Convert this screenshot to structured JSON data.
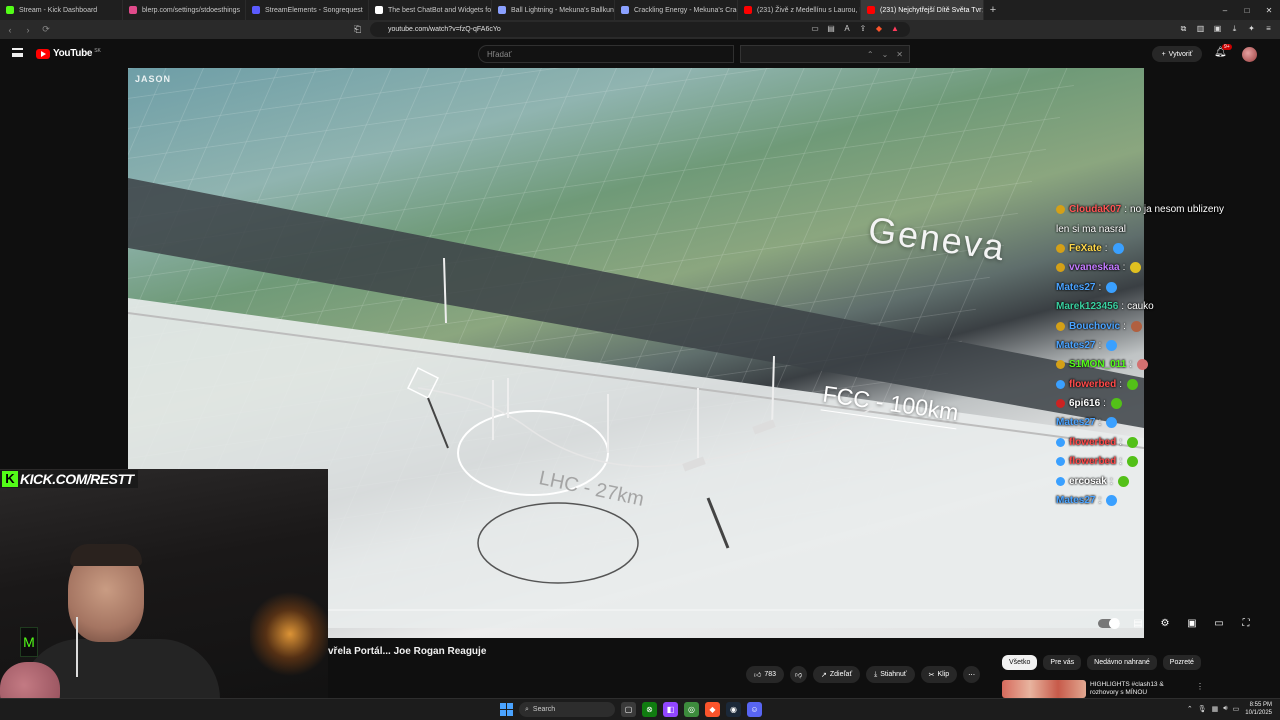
{
  "browser": {
    "tabs": [
      {
        "title": "Stream - Kick Dashboard",
        "color": "#53fc18",
        "active": false
      },
      {
        "title": "blerp.com/settings/stdoesthings",
        "color": "#e04a8a",
        "active": false
      },
      {
        "title": "StreamElements - Songrequest",
        "color": "#5b5bff",
        "active": false
      },
      {
        "title": "The best ChatBot and Widgets for K",
        "color": "#ffffff",
        "active": false
      },
      {
        "title": "Ball Lightning - Mekuna's Ballkuna",
        "color": "#8aa0ff",
        "active": false
      },
      {
        "title": "Crackling Energy - Mekuna's Crackli",
        "color": "#8aa0ff",
        "active": false
      },
      {
        "title": "(231) Živě z Medellínu s Laurou, Ko",
        "color": "#ff0000",
        "active": false
      },
      {
        "title": "(231) Nejchytřejší Dítě Světa Tvr",
        "color": "#ff0000",
        "active": true
      }
    ],
    "new_tab": "+",
    "url": "youtube.com/watch?v=fzQ-qFA6cYo",
    "window_controls": [
      "–",
      "□",
      "✕"
    ]
  },
  "masthead": {
    "logo_text": "YouTube",
    "country": "SK",
    "search_placeholder": "Hľadať",
    "create_label": "Vytvoriť",
    "notif_count": "9+"
  },
  "video": {
    "watermark": "JASON",
    "label_geneva": "Geneva",
    "label_fcc": "FCC - 100km",
    "label_lhc": "LHC - 27km",
    "progress_fraction": 0.06
  },
  "chat": [
    {
      "user": "CloudaK07",
      "color": "#ff5555",
      "badge": "#d4a017",
      "msg": "no ja nesom ublizeny"
    },
    {
      "user": "",
      "color": "#ffffff",
      "badge": "",
      "msg": "len si ma nasral"
    },
    {
      "user": "FeXate",
      "color": "#ffd84a",
      "badge": "#d4a017",
      "msg": "",
      "emote": "#3aa0ff"
    },
    {
      "user": "vvaneskaa",
      "color": "#c47aff",
      "badge": "#d4a017",
      "msg": "",
      "emote": "#e0c020"
    },
    {
      "user": "Mates27",
      "color": "#4aa3ff",
      "badge": "",
      "msg": "",
      "emote": "#3aa0ff"
    },
    {
      "user": "Marek123456",
      "color": "#3ad0a0",
      "badge": "",
      "msg": "cauko"
    },
    {
      "user": "Bouchovic",
      "color": "#4aa3ff",
      "badge": "#d4a017",
      "msg": "",
      "emote": "#b06040"
    },
    {
      "user": "Mates27",
      "color": "#4aa3ff",
      "badge": "",
      "msg": "",
      "emote": "#3aa0ff"
    },
    {
      "user": "S1MON_011",
      "color": "#53fc18",
      "badge": "#d4a017",
      "msg": "",
      "emote": "#d47070"
    },
    {
      "user": "flowerbed",
      "color": "#ff4a4a",
      "badge": "#3aa0ff",
      "msg": "",
      "emote": "#53c018"
    },
    {
      "user": "6pi616",
      "color": "#ffffff",
      "badge": "#cc2222",
      "msg": "",
      "emote": "#53c018"
    },
    {
      "user": "Mates27",
      "color": "#4aa3ff",
      "badge": "",
      "msg": "",
      "emote": "#3aa0ff"
    },
    {
      "user": "flowerbed",
      "color": "#ff4a4a",
      "badge": "#3aa0ff",
      "msg": "",
      "emote": "#53c018"
    },
    {
      "user": "flowerbed",
      "color": "#ff4a4a",
      "badge": "#3aa0ff",
      "msg": "",
      "emote": "#53c018"
    },
    {
      "user": "ercosak",
      "color": "#ffffff",
      "badge": "#3aa0ff",
      "msg": "",
      "emote": "#53c018"
    },
    {
      "user": "Mates27",
      "color": "#4aa3ff",
      "badge": "",
      "msg": "",
      "emote": "#3aa0ff"
    }
  ],
  "webcam": {
    "banner": "KICK.COM/RESTT",
    "kick_letter": "K"
  },
  "below_video": {
    "title": "vřela Portál... Joe Rogan Reaguje",
    "likes": "783",
    "share": "Zdieľať",
    "download": "Stiahnuť",
    "clip": "Klip",
    "more": "⋯"
  },
  "chips": [
    "Všetko",
    "Pre vás",
    "Nedávno nahrané",
    "Pozreté"
  ],
  "recommendation": {
    "title": "HIGHLIGHTS #clash13 & rozhovory s MÍNOU",
    "more": "⋮"
  },
  "taskbar": {
    "search": "Search",
    "time": "8:55 PM",
    "date": "10/1/2025"
  },
  "colors": {
    "youtube_red": "#ff0000",
    "kick_green": "#53fc18"
  }
}
